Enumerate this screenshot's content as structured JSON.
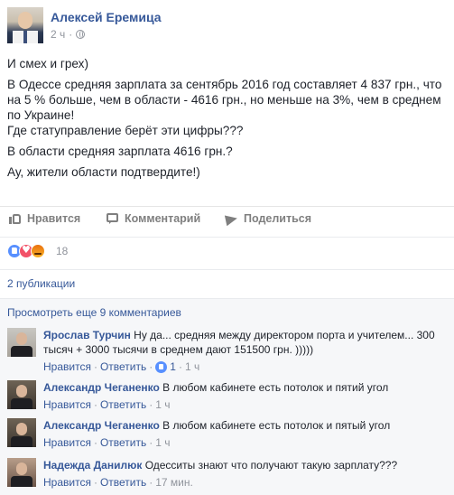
{
  "post": {
    "author": "Алексей Еремица",
    "time": "2 ч",
    "paragraphs": [
      "И смех и грех)",
      "В Одессе средняя зарплата за сентябрь 2016 год составляет 4 837 грн., что на 5 % больше, чем в области - 4616 грн., но меньше на 3%, чем в среднем по Украине!",
      "Где статуправление берёт эти цифры???",
      "В области средняя зарплата 4616 грн.?",
      "Ау, жители области подтвердите!)"
    ]
  },
  "actions": {
    "like": "Нравится",
    "comment": "Комментарий",
    "share": "Поделиться"
  },
  "reactions": {
    "count": "18"
  },
  "shares": {
    "label": "2 публикации"
  },
  "comments": {
    "more_label": "Просмотреть еще 9 комментариев",
    "items": [
      {
        "name": "Ярослав Турчин",
        "text": "Ну да... средняя между директором порта и учителем... 300 тысяч + 3000 тысячи в среднем дают 151500 грн. )))))",
        "like": "Нравится",
        "reply": "Ответить",
        "likes": "1",
        "time": "1 ч"
      },
      {
        "name": "Александр Чеганенко",
        "text": "В любом кабинете есть потолок и пятий угол",
        "like": "Нравится",
        "reply": "Ответить",
        "time": "1 ч"
      },
      {
        "name": "Александр Чеганенко",
        "text": "В любом кабинете есть потолок и пятый угол",
        "like": "Нравится",
        "reply": "Ответить",
        "time": "1 ч"
      },
      {
        "name": "Надежда Данилюк",
        "text": "Одесситы знают что получают такую зарплату???",
        "like": "Нравится",
        "reply": "Ответить",
        "time": "17 мин."
      }
    ]
  },
  "separator": "·"
}
